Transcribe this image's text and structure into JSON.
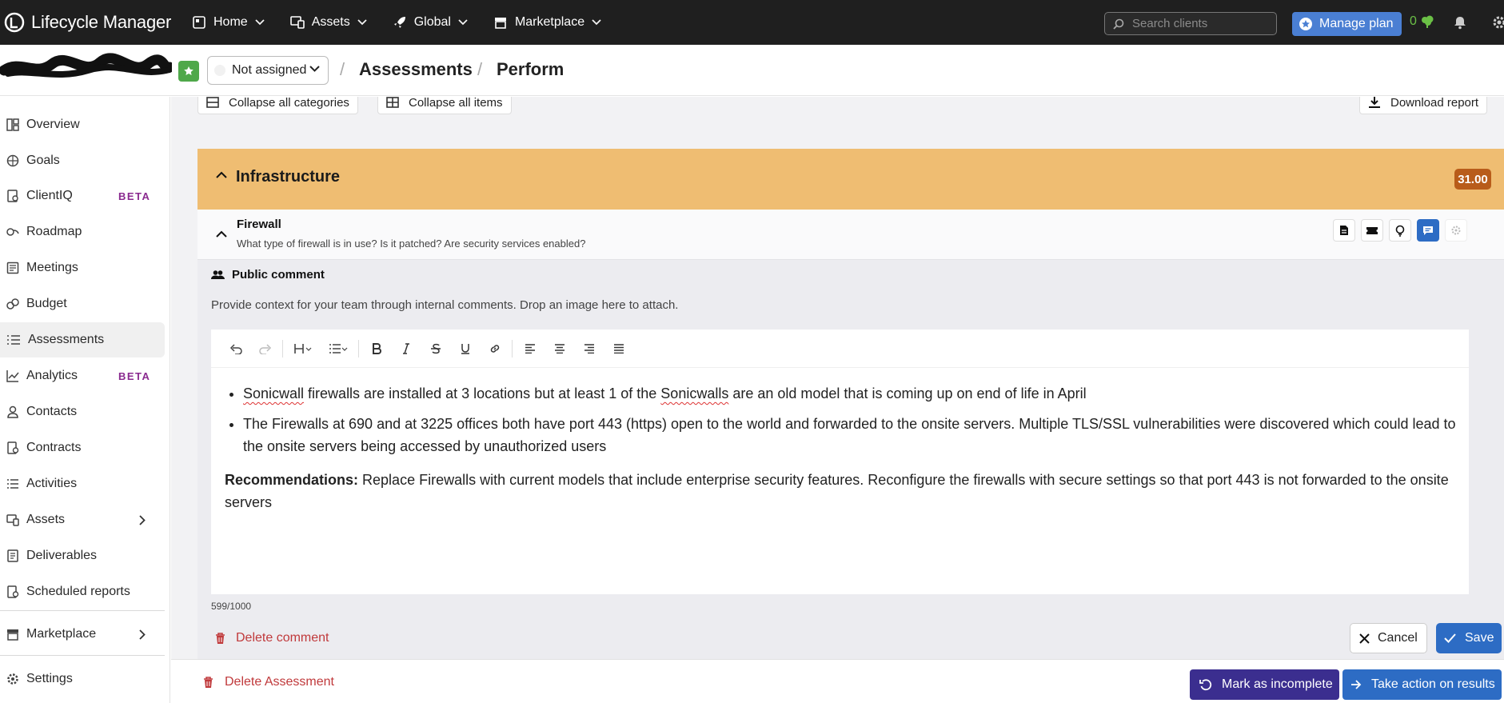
{
  "app": {
    "brand": "Lifecycle Manager",
    "nav": [
      {
        "label": "Home",
        "icon": "home-icon"
      },
      {
        "label": "Assets",
        "icon": "assets-icon"
      },
      {
        "label": "Global",
        "icon": "rocket-icon"
      },
      {
        "label": "Marketplace",
        "icon": "store-icon"
      }
    ],
    "search_placeholder": "Search clients",
    "manage_plan_label": "Manage plan",
    "credits_count": "0",
    "accent_color": "#2d6cc4"
  },
  "header": {
    "assignee": "Not assigned",
    "breadcrumb": [
      "Assessments",
      "Perform"
    ]
  },
  "sidebar": {
    "items": [
      {
        "label": "Overview",
        "icon": "overview-icon"
      },
      {
        "label": "Goals",
        "icon": "goals-icon"
      },
      {
        "label": "ClientIQ",
        "icon": "clientiq-icon",
        "badge": "BETA"
      },
      {
        "label": "Roadmap",
        "icon": "roadmap-icon"
      },
      {
        "label": "Meetings",
        "icon": "meetings-icon"
      },
      {
        "label": "Budget",
        "icon": "budget-icon"
      },
      {
        "label": "Assessments",
        "icon": "list-icon",
        "active": true
      },
      {
        "label": "Analytics",
        "icon": "analytics-icon",
        "badge": "BETA"
      },
      {
        "label": "Contacts",
        "icon": "contacts-icon"
      },
      {
        "label": "Contracts",
        "icon": "contracts-icon"
      },
      {
        "label": "Activities",
        "icon": "activities-icon"
      },
      {
        "label": "Assets",
        "icon": "assets-icon",
        "expandable": true
      },
      {
        "label": "Deliverables",
        "icon": "deliverables-icon"
      },
      {
        "label": "Scheduled reports",
        "icon": "reports-icon"
      },
      {
        "label": "Marketplace",
        "icon": "store-icon",
        "expandable": true
      },
      {
        "label": "Settings",
        "icon": "gear-icon"
      }
    ]
  },
  "toolbar": {
    "collapse_categories": "Collapse all categories",
    "collapse_items": "Collapse all items",
    "download_report": "Download report"
  },
  "category": {
    "title": "Infrastructure",
    "score": "31.00",
    "color": "#efbd72"
  },
  "item": {
    "title": "Firewall",
    "description": "What type of firewall is in use? Is it patched? Are security services enabled?"
  },
  "comment": {
    "label": "Public comment",
    "help": "Provide context for your team through internal comments. Drop an image here to attach.",
    "bullets": [
      {
        "parts": [
          {
            "text": "Sonicwall",
            "spell": true
          },
          {
            "text": " firewalls are installed at 3 locations but at least 1 of the "
          },
          {
            "text": "Sonicwalls",
            "spell": true
          },
          {
            "text": " are an old model that is coming up on end of life in April"
          }
        ]
      },
      {
        "parts": [
          {
            "text": "The Firewalls at 690 and at 3225 offices both have port 443 (https) open to the world and forwarded to the onsite servers. Multiple TLS/SSL vulnerabilities were discovered which could lead to the onsite servers being accessed by unauthorized users"
          }
        ]
      }
    ],
    "recommendation_label": "Recommendations:",
    "recommendation_text": " Replace Firewalls with current models that include enterprise security features. Reconfigure the firewalls with secure settings so that port 443 is not forwarded to the onsite servers",
    "char_count": "599/1000",
    "delete_label": "Delete comment",
    "cancel_label": "Cancel",
    "save_label": "Save"
  },
  "footer": {
    "delete_assessment": "Delete Assessment",
    "mark_incomplete": "Mark as incomplete",
    "take_action": "Take action on results"
  }
}
